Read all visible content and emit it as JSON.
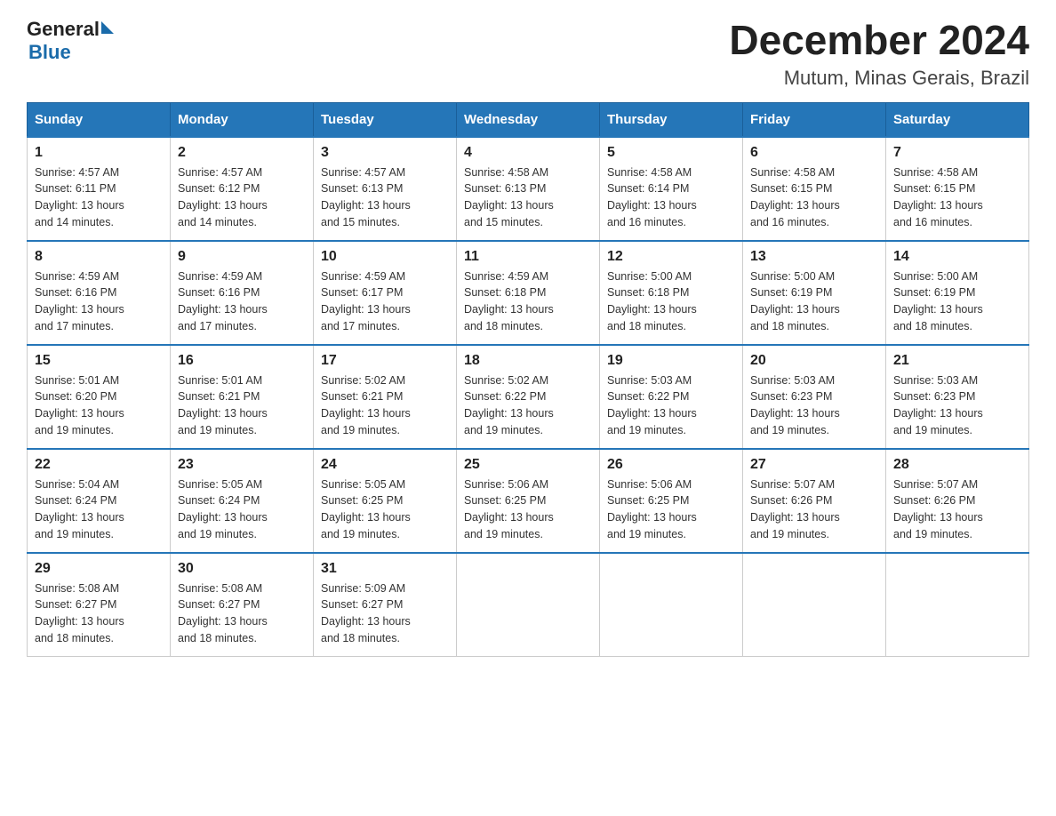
{
  "logo": {
    "text_general": "General",
    "text_blue": "Blue"
  },
  "title": "December 2024",
  "subtitle": "Mutum, Minas Gerais, Brazil",
  "days_of_week": [
    "Sunday",
    "Monday",
    "Tuesday",
    "Wednesday",
    "Thursday",
    "Friday",
    "Saturday"
  ],
  "weeks": [
    [
      {
        "day": "1",
        "sunrise": "4:57 AM",
        "sunset": "6:11 PM",
        "daylight": "13 hours and 14 minutes."
      },
      {
        "day": "2",
        "sunrise": "4:57 AM",
        "sunset": "6:12 PM",
        "daylight": "13 hours and 14 minutes."
      },
      {
        "day": "3",
        "sunrise": "4:57 AM",
        "sunset": "6:13 PM",
        "daylight": "13 hours and 15 minutes."
      },
      {
        "day": "4",
        "sunrise": "4:58 AM",
        "sunset": "6:13 PM",
        "daylight": "13 hours and 15 minutes."
      },
      {
        "day": "5",
        "sunrise": "4:58 AM",
        "sunset": "6:14 PM",
        "daylight": "13 hours and 16 minutes."
      },
      {
        "day": "6",
        "sunrise": "4:58 AM",
        "sunset": "6:15 PM",
        "daylight": "13 hours and 16 minutes."
      },
      {
        "day": "7",
        "sunrise": "4:58 AM",
        "sunset": "6:15 PM",
        "daylight": "13 hours and 16 minutes."
      }
    ],
    [
      {
        "day": "8",
        "sunrise": "4:59 AM",
        "sunset": "6:16 PM",
        "daylight": "13 hours and 17 minutes."
      },
      {
        "day": "9",
        "sunrise": "4:59 AM",
        "sunset": "6:16 PM",
        "daylight": "13 hours and 17 minutes."
      },
      {
        "day": "10",
        "sunrise": "4:59 AM",
        "sunset": "6:17 PM",
        "daylight": "13 hours and 17 minutes."
      },
      {
        "day": "11",
        "sunrise": "4:59 AM",
        "sunset": "6:18 PM",
        "daylight": "13 hours and 18 minutes."
      },
      {
        "day": "12",
        "sunrise": "5:00 AM",
        "sunset": "6:18 PM",
        "daylight": "13 hours and 18 minutes."
      },
      {
        "day": "13",
        "sunrise": "5:00 AM",
        "sunset": "6:19 PM",
        "daylight": "13 hours and 18 minutes."
      },
      {
        "day": "14",
        "sunrise": "5:00 AM",
        "sunset": "6:19 PM",
        "daylight": "13 hours and 18 minutes."
      }
    ],
    [
      {
        "day": "15",
        "sunrise": "5:01 AM",
        "sunset": "6:20 PM",
        "daylight": "13 hours and 19 minutes."
      },
      {
        "day": "16",
        "sunrise": "5:01 AM",
        "sunset": "6:21 PM",
        "daylight": "13 hours and 19 minutes."
      },
      {
        "day": "17",
        "sunrise": "5:02 AM",
        "sunset": "6:21 PM",
        "daylight": "13 hours and 19 minutes."
      },
      {
        "day": "18",
        "sunrise": "5:02 AM",
        "sunset": "6:22 PM",
        "daylight": "13 hours and 19 minutes."
      },
      {
        "day": "19",
        "sunrise": "5:03 AM",
        "sunset": "6:22 PM",
        "daylight": "13 hours and 19 minutes."
      },
      {
        "day": "20",
        "sunrise": "5:03 AM",
        "sunset": "6:23 PM",
        "daylight": "13 hours and 19 minutes."
      },
      {
        "day": "21",
        "sunrise": "5:03 AM",
        "sunset": "6:23 PM",
        "daylight": "13 hours and 19 minutes."
      }
    ],
    [
      {
        "day": "22",
        "sunrise": "5:04 AM",
        "sunset": "6:24 PM",
        "daylight": "13 hours and 19 minutes."
      },
      {
        "day": "23",
        "sunrise": "5:05 AM",
        "sunset": "6:24 PM",
        "daylight": "13 hours and 19 minutes."
      },
      {
        "day": "24",
        "sunrise": "5:05 AM",
        "sunset": "6:25 PM",
        "daylight": "13 hours and 19 minutes."
      },
      {
        "day": "25",
        "sunrise": "5:06 AM",
        "sunset": "6:25 PM",
        "daylight": "13 hours and 19 minutes."
      },
      {
        "day": "26",
        "sunrise": "5:06 AM",
        "sunset": "6:25 PM",
        "daylight": "13 hours and 19 minutes."
      },
      {
        "day": "27",
        "sunrise": "5:07 AM",
        "sunset": "6:26 PM",
        "daylight": "13 hours and 19 minutes."
      },
      {
        "day": "28",
        "sunrise": "5:07 AM",
        "sunset": "6:26 PM",
        "daylight": "13 hours and 19 minutes."
      }
    ],
    [
      {
        "day": "29",
        "sunrise": "5:08 AM",
        "sunset": "6:27 PM",
        "daylight": "13 hours and 18 minutes."
      },
      {
        "day": "30",
        "sunrise": "5:08 AM",
        "sunset": "6:27 PM",
        "daylight": "13 hours and 18 minutes."
      },
      {
        "day": "31",
        "sunrise": "5:09 AM",
        "sunset": "6:27 PM",
        "daylight": "13 hours and 18 minutes."
      },
      null,
      null,
      null,
      null
    ]
  ],
  "labels": {
    "sunrise": "Sunrise:",
    "sunset": "Sunset:",
    "daylight": "Daylight:"
  }
}
